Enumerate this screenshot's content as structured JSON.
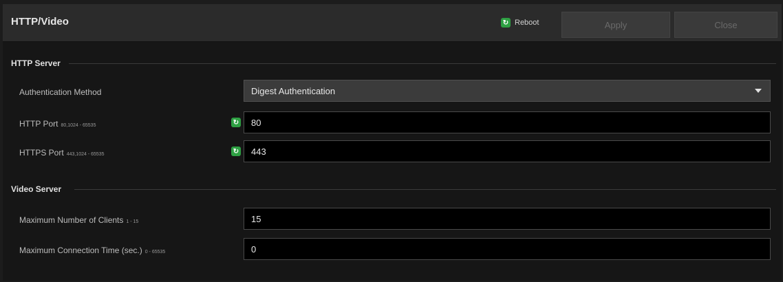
{
  "header": {
    "title": "HTTP/Video",
    "reboot_label": "Reboot",
    "apply_label": "Apply",
    "close_label": "Close"
  },
  "http_server": {
    "section_title": "HTTP Server",
    "auth_method": {
      "label": "Authentication Method",
      "value": "Digest Authentication"
    },
    "http_port": {
      "label": "HTTP Port",
      "range": "80,1024 - 65535",
      "value": "80"
    },
    "https_port": {
      "label": "HTTPS Port",
      "range": "443,1024 - 65535",
      "value": "443"
    }
  },
  "video_server": {
    "section_title": "Video Server",
    "max_clients": {
      "label": "Maximum Number of Clients",
      "range": "1 - 15",
      "value": "15"
    },
    "max_connection_time": {
      "label": "Maximum Connection Time (sec.)",
      "range": "0 - 65535",
      "value": "0"
    }
  },
  "colors": {
    "accent_green": "#2ea043",
    "background": "#161616",
    "header": "#2b2b2b"
  },
  "icons": {
    "reboot": "reboot-indicator-icon",
    "dropdown": "chevron-down-icon"
  }
}
